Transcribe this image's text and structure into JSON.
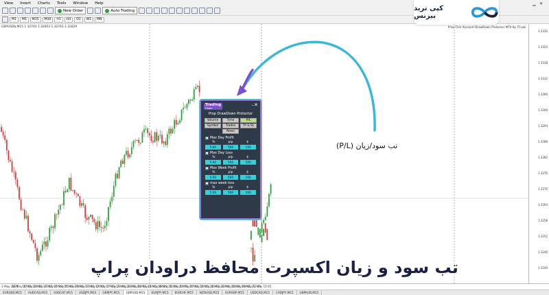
{
  "menu": [
    "View",
    "Insert",
    "Charts",
    "Tools",
    "Window",
    "Help"
  ],
  "toolbar": {
    "new_order": "New Order",
    "auto_trading": "Auto Trading",
    "icons": [
      "new-chart-icon",
      "profiles-icon",
      "market-watch-icon",
      "data-window-icon",
      "navigator-icon",
      "terminal-icon",
      "tester-icon",
      "zoom-in-icon",
      "zoom-out-icon",
      "tile-icon",
      "scroll-icon",
      "shift-icon",
      "indicators-icon",
      "templates-icon"
    ]
  },
  "timeframes": [
    "M1",
    "M5",
    "M15",
    "M30",
    "H1",
    "H4",
    "D1",
    "W1",
    "MN"
  ],
  "chart": {
    "symbol_label": "GBPUSDb,M15  1.32763 1.32853 1.32763 1.32829",
    "ea_label": "Prop Firm Account DrawDown Protector MT4 By TFLab",
    "price_ticks": [
      "1.3330",
      "1.3324",
      "1.3318",
      "1.3312",
      "1.3306",
      "1.3300",
      "1.3294",
      "1.3288",
      "1.3282",
      "1.3276",
      "1.3270",
      "1.3264",
      "1.3258",
      "1.3252",
      "1.3246",
      "1.3240"
    ],
    "time_ticks": [
      "3 May 2024",
      "16 May 17:45",
      "16 May 20:45",
      "16 May 23:45",
      "17 May 02:45",
      "17 May 05:45",
      "17 May 08:45",
      "17 May 11:45",
      "17 May 14:45",
      "17 May 17:45",
      "17 May 20:45",
      "17 May 23:45",
      "20 May 02:45",
      "20 May 05:45",
      "20 May 08:45",
      "20 May 11:45",
      "20 May 14:45",
      "20 May 17:45",
      "20 May 20:45",
      "21 May 00:45",
      "21 May 03:45",
      "21 May 06:45",
      "21 May 09:45",
      "21 May 12:45",
      "21 May 15:45",
      "21 May 18:45",
      "21 May 21:45"
    ]
  },
  "logo": {
    "text": "کپی ترید بیزنس",
    "accent": "#2a9ad6"
  },
  "panel": {
    "brand": "Trading",
    "brand_sub": "Finder",
    "title": "Prop DrawDown Protector",
    "tabs": [
      {
        "label": "Volume",
        "active": false
      },
      {
        "label": "Time",
        "active": false
      },
      {
        "label": "P/L",
        "active": true
      },
      {
        "label": "Symbol",
        "active": false
      },
      {
        "label": "Trades",
        "active": false
      },
      {
        "label": "TP & SL",
        "active": false
      },
      {
        "label": "News",
        "active": false
      }
    ],
    "sections": [
      {
        "label": "Max Day Profit",
        "cols": [
          "%",
          "pip",
          "$"
        ],
        "values": [
          "5.00",
          "500",
          "100"
        ]
      },
      {
        "label": "Max Day Loss",
        "cols": [
          "%",
          "pip",
          "$"
        ],
        "values": [
          "5.00",
          "500",
          "100"
        ]
      },
      {
        "label": "Max Week Profit",
        "cols": [
          "%",
          "pip",
          "$"
        ],
        "values": [
          "5.00",
          "500",
          "100"
        ]
      },
      {
        "label": "max week loss",
        "cols": [
          "%",
          "pip",
          "$"
        ],
        "values": [
          "5.00",
          "500",
          "100"
        ]
      }
    ],
    "border_color": "#9a6fd8"
  },
  "annotation": {
    "label": "تب سود/زیان (P/L)",
    "arrow_color": "#3ab8d6"
  },
  "caption": "تب سود و زیان اکسپرت محافظ دراودان پراپ",
  "bottom_tabs": [
    {
      "label": "EURUSD,M15",
      "active": false
    },
    {
      "label": "AUDCAD,M15",
      "active": false
    },
    {
      "label": "USDCHF,M15",
      "active": false
    },
    {
      "label": "USDJPY,M15",
      "active": false
    },
    {
      "label": "GBPJPY,M15",
      "active": false
    },
    {
      "label": "GBPUSD,M15",
      "active": true
    },
    {
      "label": "EURJPY,M15",
      "active": false
    },
    {
      "label": "EURCHF,M15",
      "active": false
    },
    {
      "label": "NZDUSD,M15",
      "active": false
    },
    {
      "label": "EURGBP,M15",
      "active": false
    },
    {
      "label": "USDCAD,M15",
      "active": false
    },
    {
      "label": "CADJPY,M15",
      "active": false
    },
    {
      "label": "GBPAUD,M15",
      "active": false
    }
  ],
  "colors": {
    "bull": "#2e9e3c",
    "bear": "#d43a3a"
  }
}
